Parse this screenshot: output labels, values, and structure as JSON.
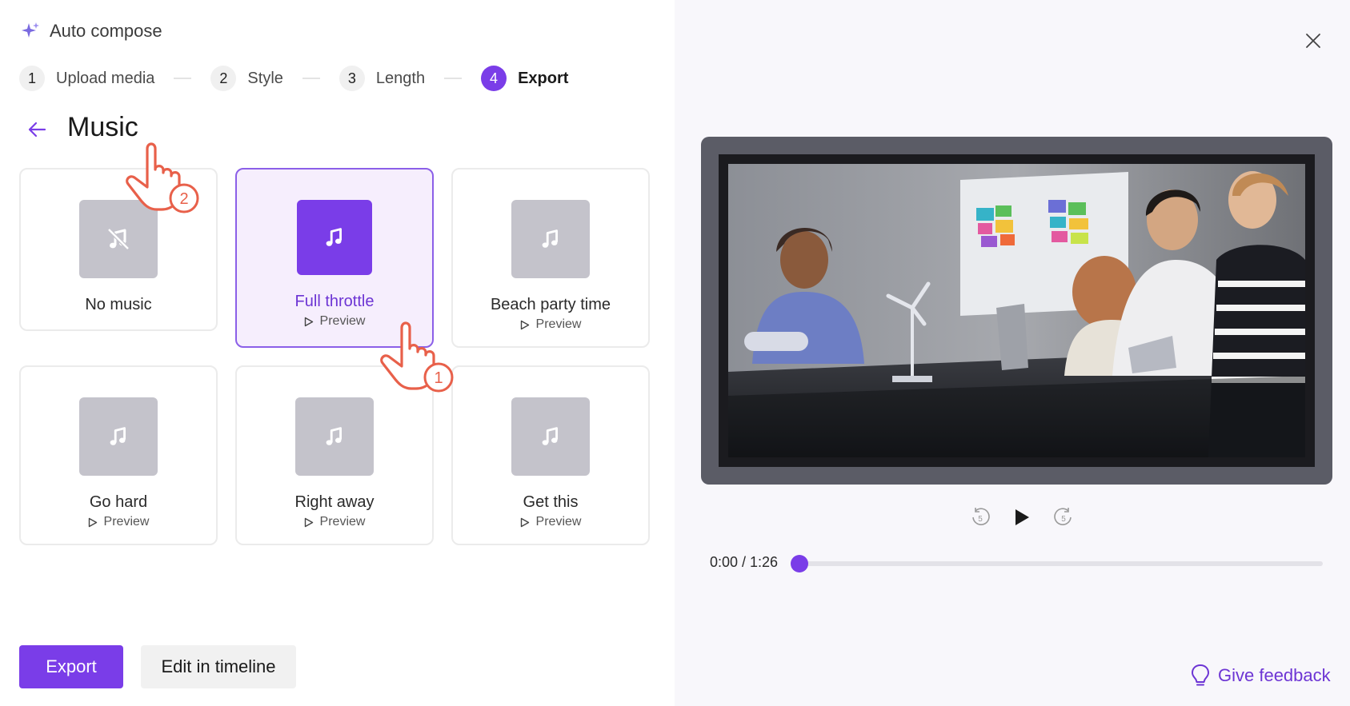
{
  "header": {
    "app_title": "Auto compose",
    "sparkle_icon": "sparkle-icon"
  },
  "stepper": [
    {
      "num": "1",
      "label": "Upload media",
      "active": false
    },
    {
      "num": "2",
      "label": "Style",
      "active": false
    },
    {
      "num": "3",
      "label": "Length",
      "active": false
    },
    {
      "num": "4",
      "label": "Export",
      "active": true
    }
  ],
  "section": {
    "title": "Music",
    "back_icon": "arrow-left-icon"
  },
  "music_options": [
    {
      "title": "No music",
      "preview": "",
      "icon": "music-off-icon",
      "selected": false
    },
    {
      "title": "Full throttle",
      "preview": "Preview",
      "icon": "music-note-icon",
      "selected": true
    },
    {
      "title": "Beach party time",
      "preview": "Preview",
      "icon": "music-note-icon",
      "selected": false
    },
    {
      "title": "Go hard",
      "preview": "Preview",
      "icon": "music-note-icon",
      "selected": false
    },
    {
      "title": "Right away",
      "preview": "Preview",
      "icon": "music-note-icon",
      "selected": false
    },
    {
      "title": "Get this",
      "preview": "Preview",
      "icon": "music-note-icon",
      "selected": false
    }
  ],
  "annotations": {
    "cursor_1": "1",
    "cursor_2": "2"
  },
  "actions": {
    "export_label": "Export",
    "edit_label": "Edit in timeline"
  },
  "player": {
    "time": "0:00 / 1:26",
    "progress": 0,
    "rewind_label": "5",
    "forward_label": "5"
  },
  "feedback": {
    "label": "Give feedback",
    "icon": "lightbulb-icon"
  },
  "colors": {
    "accent": "#7a3de8",
    "selected_bg": "#f6eefd",
    "cursor": "#e8604a"
  }
}
